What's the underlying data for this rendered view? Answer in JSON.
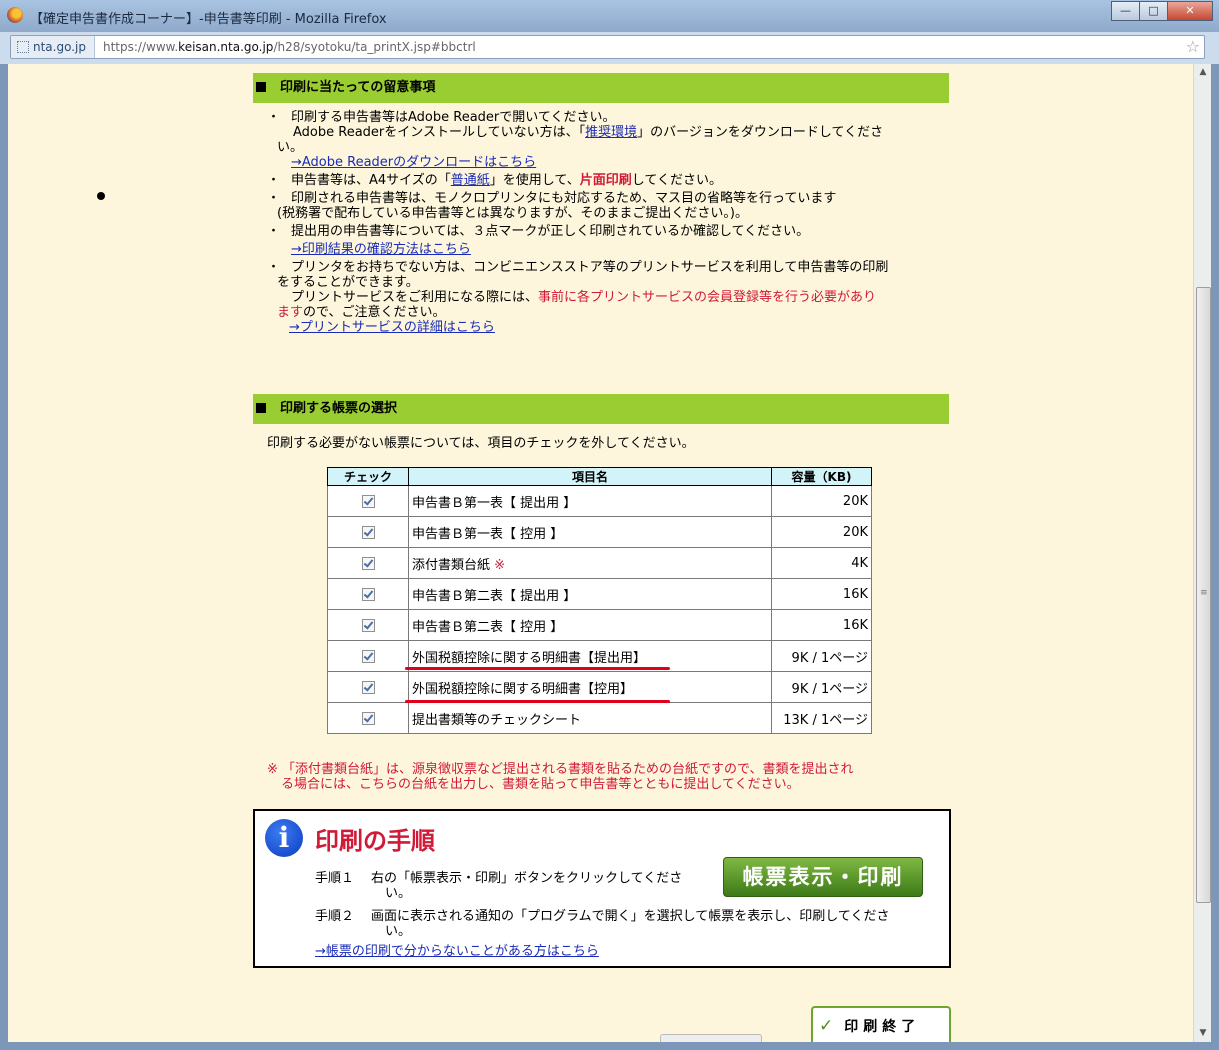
{
  "window": {
    "title": "【確定申告書作成コーナー】-申告書等印刷 - Mozilla Firefox",
    "minimize": "—",
    "maximize": "□",
    "close": "✕"
  },
  "urlbar": {
    "site": "nta.go.jp",
    "url_prefix": "https://www.",
    "url_domain": "keisan.nta.go.jp",
    "url_path": "/h28/syotoku/ta_printX.jsp#bbctrl"
  },
  "notes_section": {
    "heading": "印刷に当たっての留意事項",
    "bullet": "・",
    "n1_line1": "印刷する申告書等はAdobe Readerで開いてください。",
    "n1_line2_pre": "Adobe Readerをインストールしていない方は、「",
    "n1_link": "推奨環境",
    "n1_line2_post": "」のバージョンをダウンロードしてくださ",
    "n1_line3": "い。",
    "n1_dl_link": "→Adobe Readerのダウンロードはこちら",
    "n2_pre": "申告書等は、A4サイズの「",
    "n2_link": "普通紙",
    "n2_mid": "」を使用して、",
    "n2_red": "片面印刷",
    "n2_post": "してください。",
    "n3_line1": "印刷される申告書等は、モノクロプリンタにも対応するため、マス目の省略等を行っています",
    "n3_line2": "(税務署で配布している申告書等とは異なりますが、そのままご提出ください。)。",
    "n4_line1": "提出用の申告書等については、３点マークが正しく印刷されているか確認してください。",
    "n4_link": "→印刷結果の確認方法はこちら",
    "n5_line1": "プリンタをお持ちでない方は、コンビニエンスストア等のプリントサービスを利用して申告書等の印刷",
    "n5_line2": "をすることができます。",
    "n5_line3_pre": "プリントサービスをご利用になる際には、",
    "n5_line3_red": "事前に各プリントサービスの会員登録等を行う必要があり",
    "n5_line4_red": "ます",
    "n5_line4_post": "ので、ご注意ください。",
    "n5_link": "→プリントサービスの詳細はこちら"
  },
  "select_section": {
    "heading": "印刷する帳票の選択",
    "instruction": "印刷する必要がない帳票については、項目のチェックを外してください。",
    "col_check": "チェック",
    "col_name": "項目名",
    "col_size": "容量（KB)",
    "rows": [
      {
        "name": "申告書Ｂ第一表【 提出用 】",
        "mark": "",
        "size": "20K",
        "checked": true
      },
      {
        "name": "申告書Ｂ第一表【 控用 】",
        "mark": "",
        "size": "20K",
        "checked": true
      },
      {
        "name": "添付書類台紙 ",
        "mark": "※",
        "size": "4K",
        "checked": true
      },
      {
        "name": "申告書Ｂ第二表【 提出用 】",
        "mark": "",
        "size": "16K",
        "checked": true
      },
      {
        "name": "申告書Ｂ第二表【 控用 】",
        "mark": "",
        "size": "16K",
        "checked": true
      },
      {
        "name": "外国税額控除に関する明細書【提出用】",
        "mark": "",
        "size": "9K / 1ページ",
        "checked": true
      },
      {
        "name": "外国税額控除に関する明細書【控用】",
        "mark": "",
        "size": "9K / 1ページ",
        "checked": true
      },
      {
        "name": "提出書類等のチェックシート",
        "mark": "",
        "size": "13K / 1ページ",
        "checked": true
      }
    ],
    "footnote_line1": "※ 「添付書類台紙」は、源泉徴収票など提出される書類を貼るための台紙ですので、書類を提出され",
    "footnote_line2": "る場合には、こちらの台紙を出力し、書類を貼って申告書等とともに提出してください。"
  },
  "procedure": {
    "icon_glyph": "i",
    "title": "印刷の手順",
    "step1_label": "手順１",
    "step1_line1": "右の「帳票表示・印刷」ボタンをクリックしてくださ",
    "step1_line2": "い。",
    "step2_label": "手順２",
    "step2_line1": "画面に表示される通知の「プログラムで開く」を選択して帳票を表示し、印刷してくださ",
    "step2_line2": "い。",
    "help_link": "→帳票の印刷で分からないことがある方はこちら",
    "display_button": "帳票表示・印刷"
  },
  "end_button": {
    "check": "✓",
    "label": "印刷終了"
  },
  "colors": {
    "section_header": "#9acd32",
    "page_bg": "#fdf6dc",
    "link": "#1a2bb5",
    "emphasis_red": "#d01a37",
    "table_header": "#d2f3f8",
    "annotation_red": "#e0001a"
  }
}
